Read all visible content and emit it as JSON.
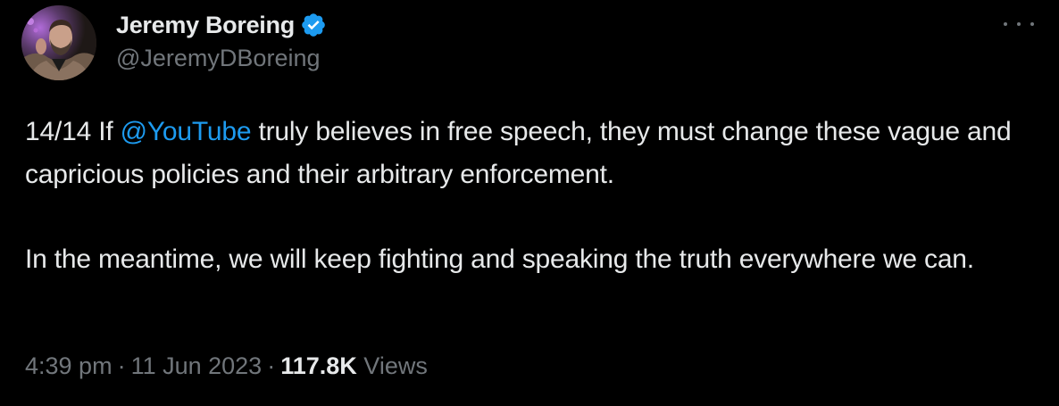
{
  "author": {
    "display_name": "Jeremy Boreing",
    "handle": "@JeremyDBoreing",
    "verified_color": "#1d9bf0"
  },
  "tweet": {
    "prefix": "14/14 If ",
    "mention": "@YouTube",
    "line1_rest": " truly believes in free speech, they must change these vague and capricious policies and their arbitrary enforcement.",
    "paragraph2": "In the meantime, we will keep fighting and speaking the truth everywhere we can."
  },
  "meta": {
    "time": "4:39 pm",
    "separator": "·",
    "date": "11 Jun 2023",
    "views_count": "117.8K",
    "views_label": "Views"
  },
  "colors": {
    "background": "#000000",
    "text": "#e7e9ea",
    "secondary": "#71767b",
    "accent": "#1d9bf0"
  },
  "icons": {
    "more": "more-options-icon",
    "verified": "verified-badge-icon"
  }
}
